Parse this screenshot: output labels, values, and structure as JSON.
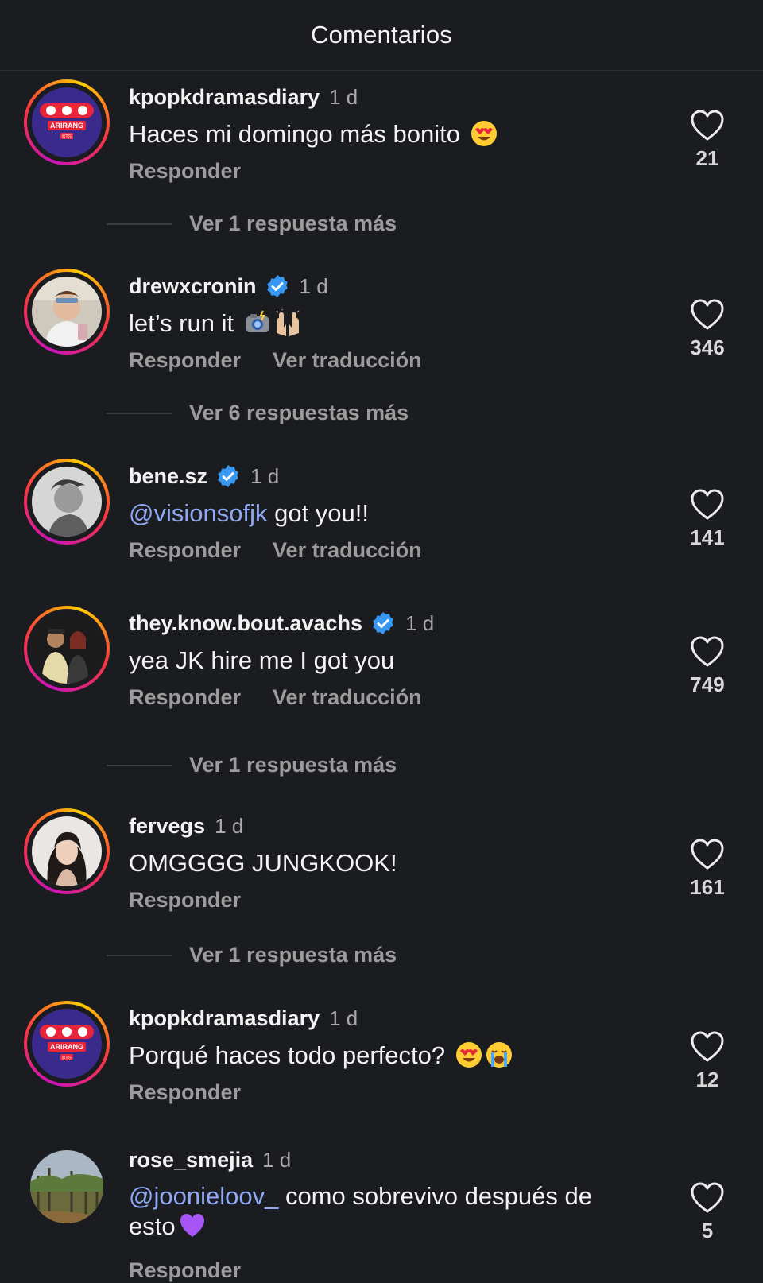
{
  "header": {
    "title": "Comentarios"
  },
  "comments": [
    {
      "username": "kpopkdramasdiary",
      "verified": false,
      "time": "1 d",
      "text": "Haces mi domingo más bonito",
      "emojis": [
        "heart-eyes-emoji"
      ],
      "reply_label": "Responder",
      "likes": "21",
      "avatar_text": "ARIRANG",
      "avatar_subtext": "BTS"
    },
    {
      "username": "drewxcronin",
      "verified": true,
      "time": "1 d",
      "text": "let’s run it",
      "emojis": [
        "camera-flash-emoji",
        "raised-hands-emoji"
      ],
      "reply_label": "Responder",
      "translate_label": "Ver traducción",
      "likes": "346"
    },
    {
      "username": "bene.sz",
      "verified": true,
      "time": "1 d",
      "mention": "@visionsofjk",
      "text": " got you!!",
      "reply_label": "Responder",
      "translate_label": "Ver traducción",
      "likes": "141"
    },
    {
      "username": "they.know.bout.avachs",
      "verified": true,
      "time": "1 d",
      "text": "yea JK hire me I got you",
      "reply_label": "Responder",
      "translate_label": "Ver traducción",
      "likes": "749"
    },
    {
      "username": "fervegs",
      "verified": false,
      "time": "1 d",
      "text": "OMGGGG JUNGKOOK!",
      "reply_label": "Responder",
      "likes": "161"
    },
    {
      "username": "kpopkdramasdiary",
      "verified": false,
      "time": "1 d",
      "text": "Porqué haces todo perfecto?",
      "emojis": [
        "heart-eyes-emoji",
        "loudly-crying-emoji"
      ],
      "reply_label": "Responder",
      "likes": "12",
      "avatar_text": "ARIRANG",
      "avatar_subtext": "BTS"
    },
    {
      "username": "rose_smejia",
      "verified": false,
      "time": "1 d",
      "mention": "@joonieloov_",
      "text": " como sobrevivo después de esto",
      "emojis": [
        "purple-heart-emoji"
      ],
      "reply_label": "Responder",
      "likes": "5"
    }
  ],
  "view_replies": [
    "Ver 1 respuesta más",
    "Ver 6 respuestas más",
    "Ver 1 respuesta más",
    "Ver 1 respuesta más"
  ],
  "colors": {
    "background": "#1a1c20",
    "mention": "#8fa9f5",
    "verified": "#3897f0",
    "secondary_text": "#9c9c9c"
  }
}
